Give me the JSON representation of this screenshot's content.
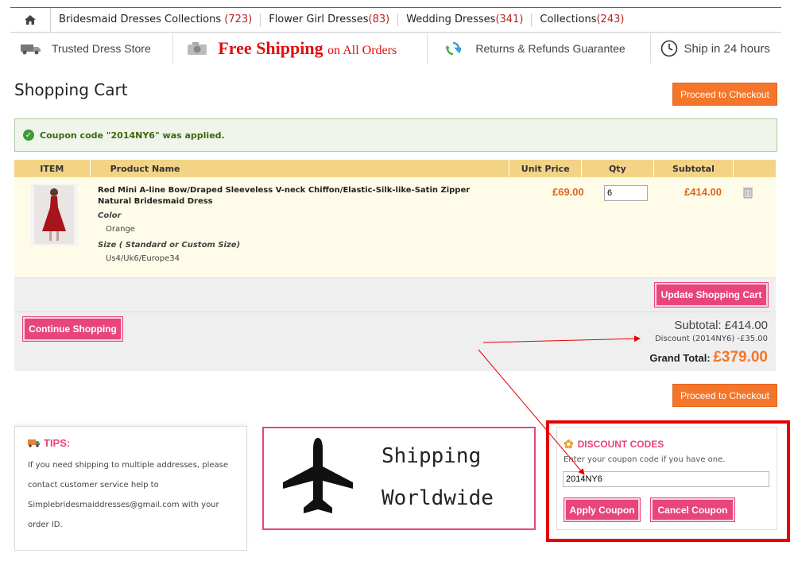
{
  "nav": {
    "items": [
      {
        "label": "Bridesmaid Dresses Collections ",
        "count": "(723)"
      },
      {
        "label": "Flower Girl Dresses",
        "count": "(83)"
      },
      {
        "label": "Wedding Dresses",
        "count": "(341)"
      },
      {
        "label": "Collections",
        "count": "(243)"
      }
    ]
  },
  "features": {
    "trusted": "Trusted Dress Store",
    "free_shipping": "Free Shipping",
    "free_shipping_sub": "on All Orders",
    "returns": "Returns & Refunds Guarantee",
    "ship24": "Ship in 24 hours"
  },
  "page": {
    "title": "Shopping Cart",
    "checkout_label": "Proceed to Checkout"
  },
  "message": "Coupon code \"2014NY6\" was applied.",
  "table": {
    "headers": [
      "ITEM",
      "Product Name",
      "Unit Price",
      "Qty",
      "Subtotal"
    ],
    "row": {
      "name": "Red Mini A-line Bow/Draped Sleeveless V-neck Chiffon/Elastic-Silk-like-Satin Zipper Natural Bridesmaid Dress",
      "color_label": "Color",
      "color_value": "Orange",
      "size_label": "Size ( Standard or Custom Size)",
      "size_value": "Us4/Uk6/Europe34",
      "unit_price": "£69.00",
      "qty": "6",
      "subtotal": "£414.00"
    }
  },
  "actions": {
    "update": "Update Shopping Cart",
    "continue": "Continue Shopping"
  },
  "totals": {
    "subtotal": "Subtotal: £414.00",
    "discount": "Discount (2014NY6) -£35.00",
    "grand_label": "Grand Total:",
    "grand_value": "£379.00"
  },
  "tips": {
    "title": "TIPS:",
    "text": "If you need shipping to multiple addresses, please contact customer service help to Simplebridesmaiddresses@gmail.com with your order ID."
  },
  "shipping_banner": {
    "line1": "Shipping",
    "line2": "Worldwide"
  },
  "discount_codes": {
    "title": "DISCOUNT CODES",
    "hint": "Enter your coupon code if you have one.",
    "value": "2014NY6",
    "apply": "Apply Coupon",
    "cancel": "Cancel Coupon"
  },
  "colors": {
    "accent_orange": "#f5762a",
    "pink": "#e8457c",
    "annotation_red": "#e60000"
  }
}
